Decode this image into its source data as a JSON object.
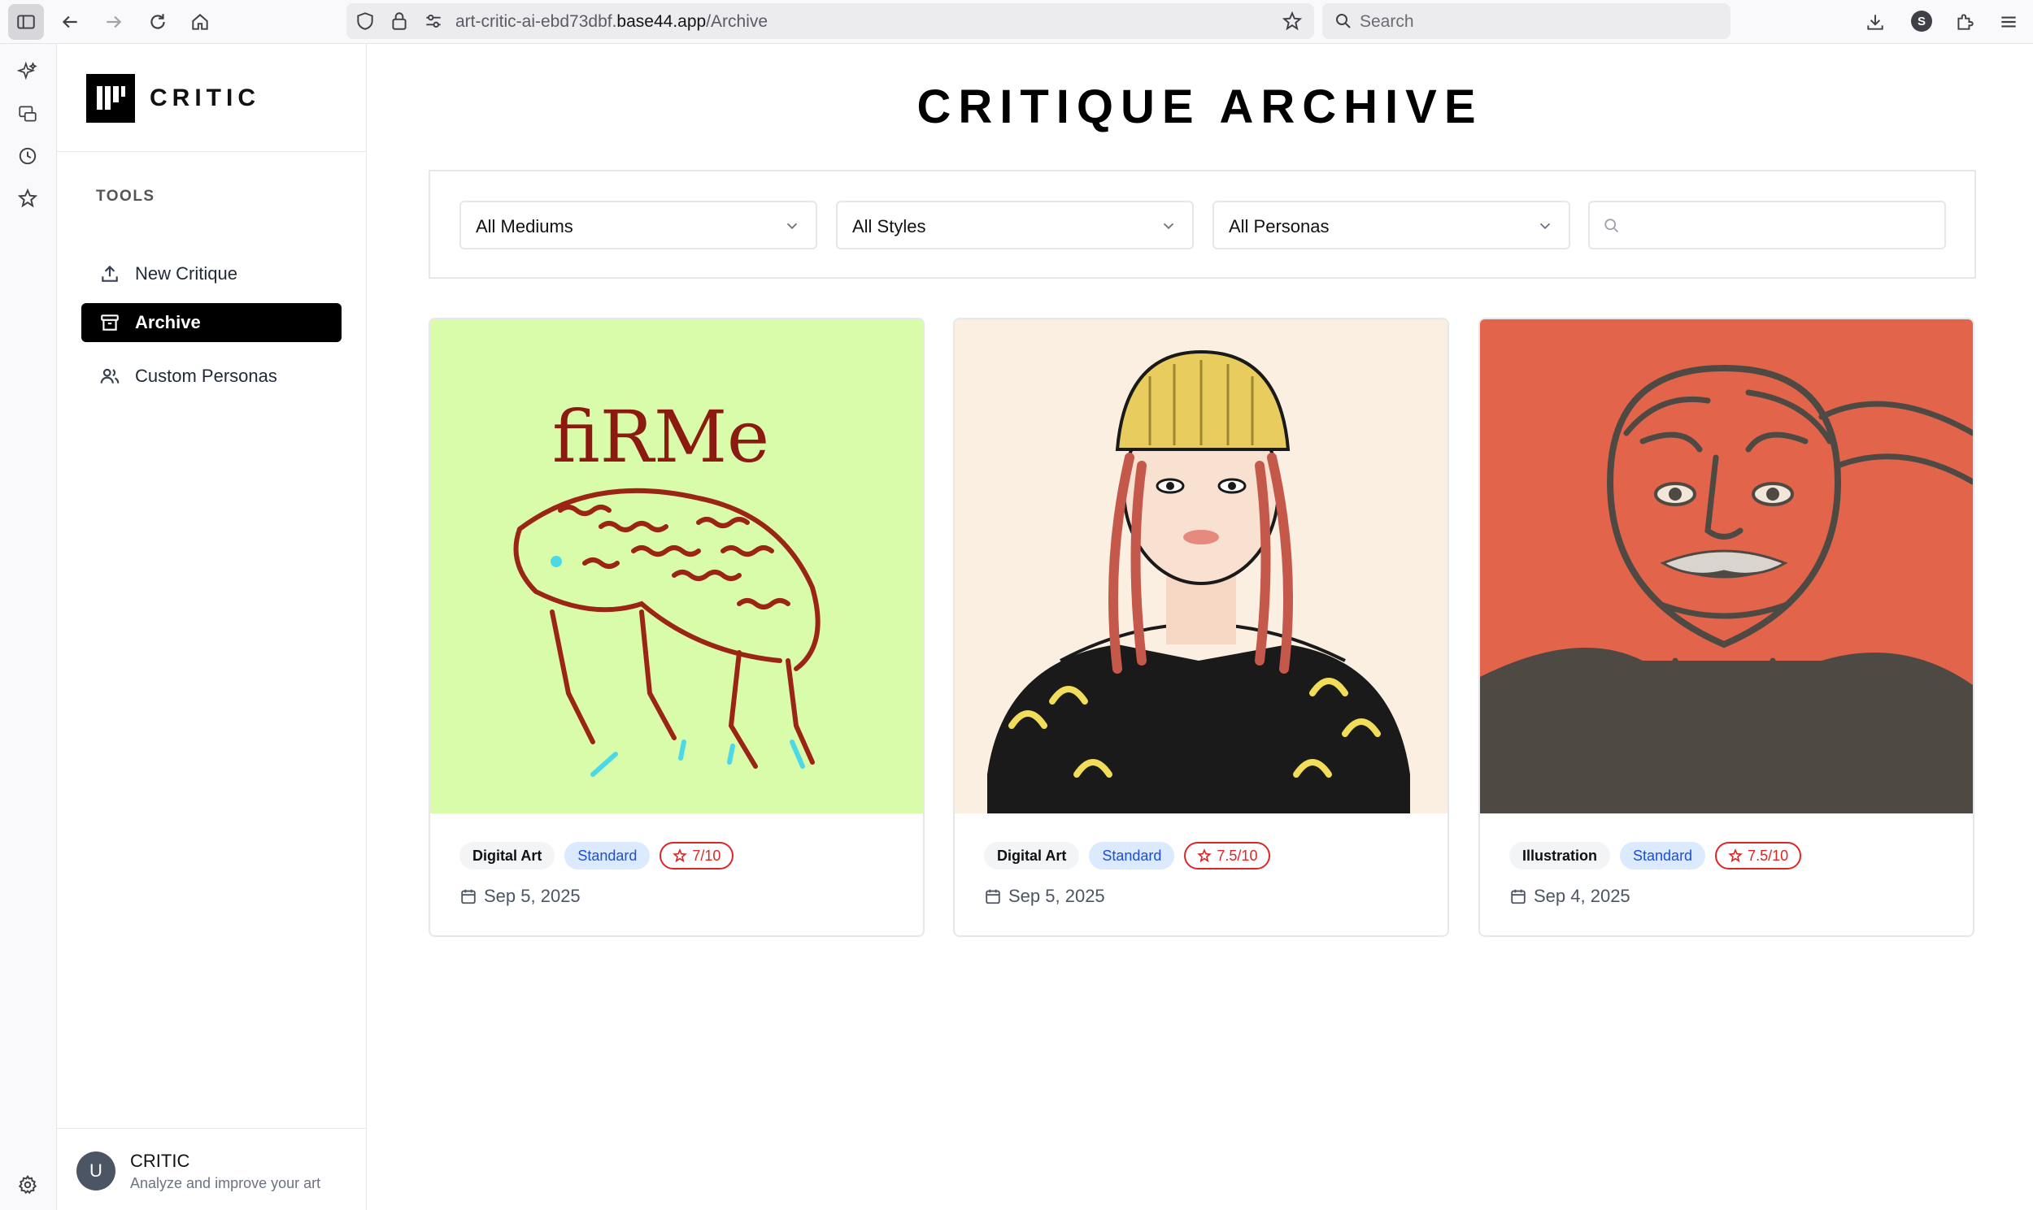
{
  "browser": {
    "url_prefix": "art-critic-ai-ebd73dbf.",
    "url_host": "base44.app",
    "url_path": "/Archive",
    "search_placeholder": "Search",
    "profile_initial": "S"
  },
  "sidebar": {
    "logo_text": "CRITIC",
    "section_label": "TOOLS",
    "items": [
      {
        "label": "New Critique",
        "icon": "upload-icon",
        "active": false
      },
      {
        "label": "Archive",
        "icon": "archive-icon",
        "active": true
      },
      {
        "label": "Custom Personas",
        "icon": "users-icon",
        "active": false
      }
    ],
    "footer": {
      "avatar_initial": "U",
      "title": "CRITIC",
      "subtitle": "Analyze and improve your art"
    }
  },
  "main": {
    "title": "CRITIQUE ARCHIVE",
    "filters": {
      "medium": "All Mediums",
      "style": "All Styles",
      "persona": "All Personas",
      "search_value": ""
    },
    "cards": [
      {
        "medium": "Digital Art",
        "persona": "Standard",
        "score": "7/10",
        "date": "Sep 5, 2025",
        "image_text": "fiRMe",
        "bg": "#d9fcaa"
      },
      {
        "medium": "Digital Art",
        "persona": "Standard",
        "score": "7.5/10",
        "date": "Sep 5, 2025",
        "bg": "#fbefe2"
      },
      {
        "medium": "Illustration",
        "persona": "Standard",
        "score": "7.5/10",
        "date": "Sep 4, 2025",
        "bg": "#e2644a"
      }
    ]
  },
  "colors": {
    "active_nav_bg": "#000000",
    "persona_tag_bg": "#dbeafe",
    "persona_tag_text": "#1d4ed8",
    "score_red": "#dc2626"
  }
}
